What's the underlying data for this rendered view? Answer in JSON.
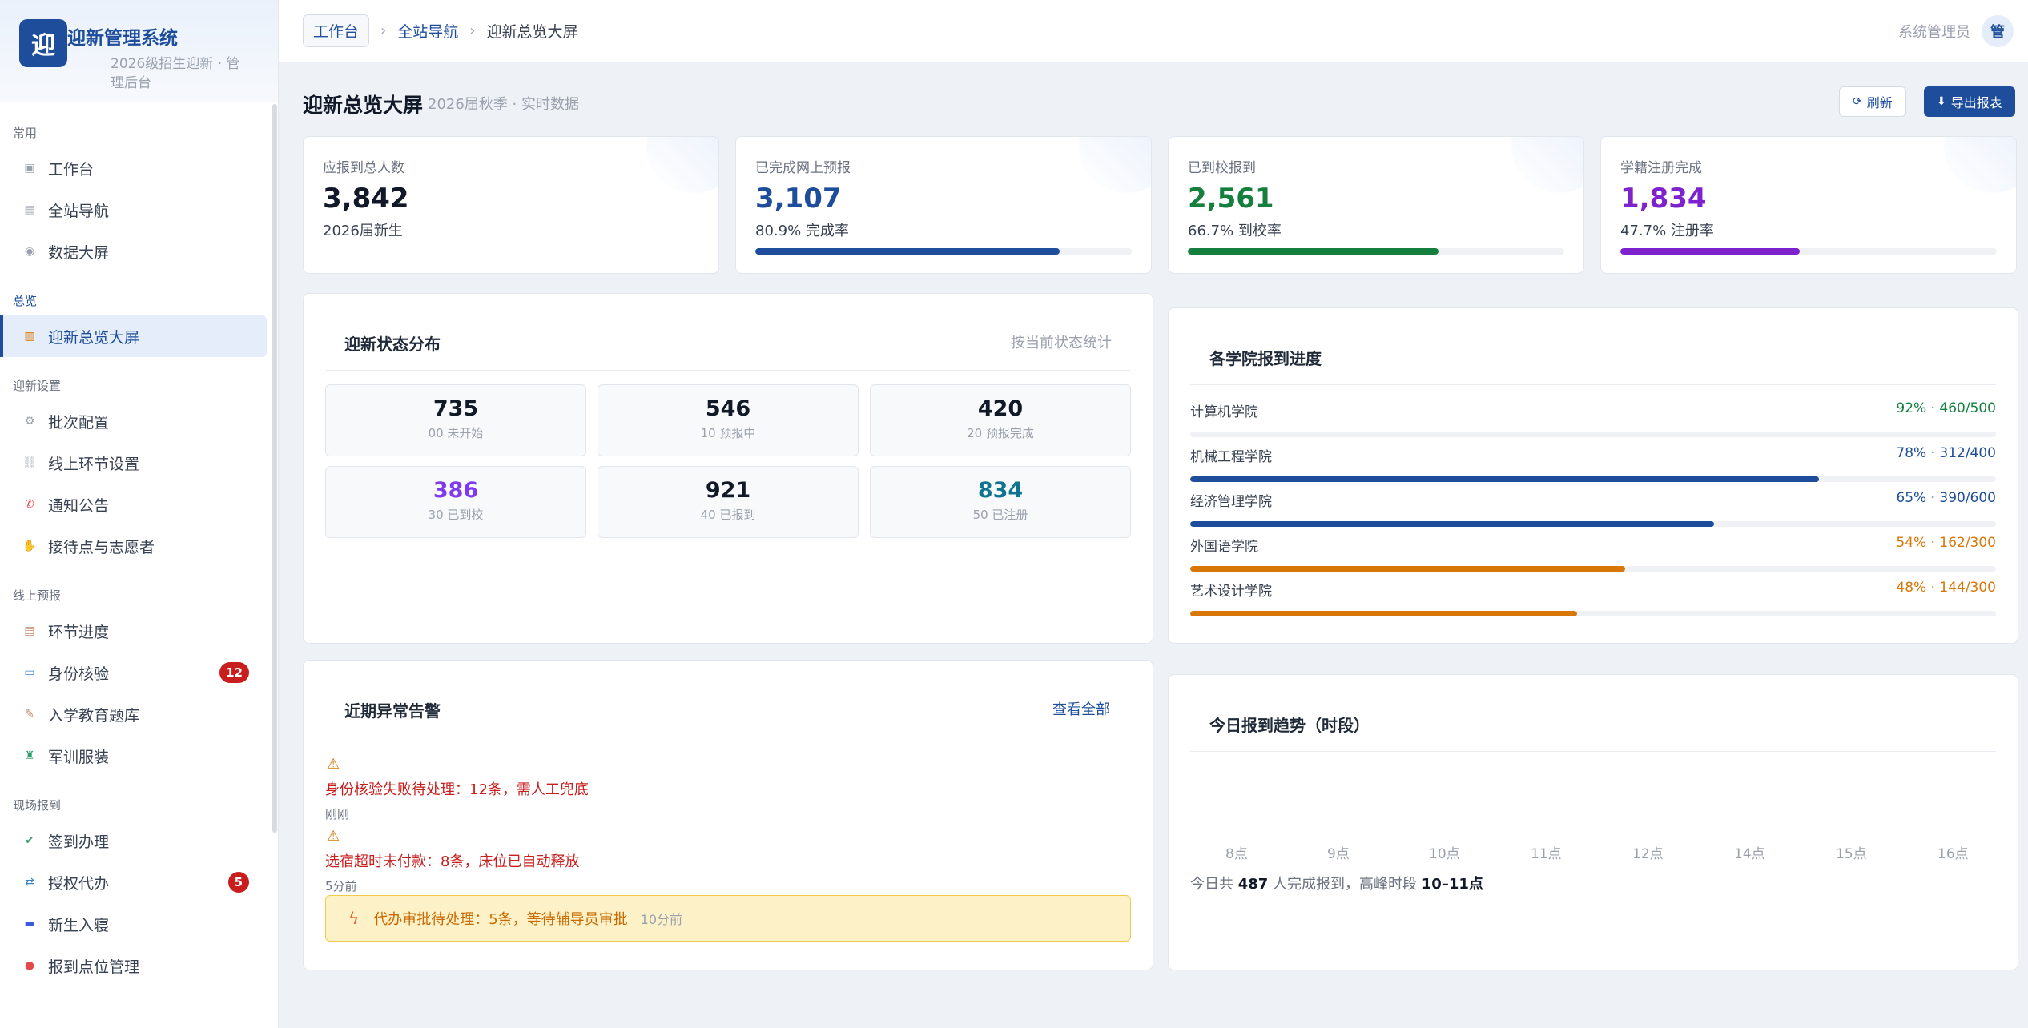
{
  "brand": {
    "logo_char": "迎",
    "title": "迎新管理系统",
    "subtitle": "2026级招生迎新 · 管理后台"
  },
  "sidebar": {
    "groups": [
      {
        "title": "常用",
        "items": [
          {
            "label": "工作台",
            "icon": "workbench-icon"
          },
          {
            "label": "全站导航",
            "icon": "grid-icon"
          },
          {
            "label": "数据大屏",
            "icon": "screen-icon"
          }
        ]
      },
      {
        "title": "总览",
        "items": [
          {
            "label": "迎新总览大屏",
            "icon": "chart-icon"
          }
        ]
      },
      {
        "title": "迎新设置",
        "items": [
          {
            "label": "批次配置",
            "icon": "gear-icon"
          },
          {
            "label": "线上环节设置",
            "icon": "link-icon"
          },
          {
            "label": "通知公告",
            "icon": "megaphone-icon"
          },
          {
            "label": "接待点与志愿者",
            "icon": "volunteer-icon"
          }
        ]
      },
      {
        "title": "线上预报",
        "items": [
          {
            "label": "环节进度",
            "icon": "clipboard-icon"
          },
          {
            "label": "身份核验",
            "icon": "id-card-icon",
            "badge": "12"
          },
          {
            "label": "入学教育题库",
            "icon": "memo-icon"
          },
          {
            "label": "军训服装",
            "icon": "shirt-icon"
          }
        ]
      },
      {
        "title": "现场报到",
        "items": [
          {
            "label": "签到办理",
            "icon": "check-icon"
          },
          {
            "label": "授权代办",
            "icon": "swap-icon",
            "badge": "5"
          },
          {
            "label": "新生入寝",
            "icon": "bed-icon"
          },
          {
            "label": "报到点位管理",
            "icon": "pin-icon"
          }
        ]
      }
    ]
  },
  "topbar": {
    "crumb_home": "工作台",
    "crumb_nav": "全站导航",
    "crumb_current": "迎新总览大屏",
    "admin_name": "系统管理员",
    "admin_avatar": "管"
  },
  "page": {
    "title": "迎新总览大屏",
    "subtitle": "2026届秋季 · 实时数据",
    "refresh_label": "刷新",
    "export_label": "导出报表"
  },
  "stats": [
    {
      "label": "应报到总人数",
      "value": "3,842",
      "desc": "2026届新生",
      "color": "#111827"
    },
    {
      "label": "已完成网上预报",
      "value": "3,107",
      "desc": "80.9% 完成率",
      "color": "#1e4e9b",
      "progress": 0.809
    },
    {
      "label": "已到校报到",
      "value": "2,561",
      "desc": "66.7% 到校率",
      "color": "#15803d",
      "progress": 0.667
    },
    {
      "label": "学籍注册完成",
      "value": "1,834",
      "desc": "47.7% 注册率",
      "color": "#7e22ce",
      "progress": 0.477
    }
  ],
  "status_panel": {
    "title": "迎新状态分布",
    "hint": "按当前状态统计",
    "cells": [
      {
        "value": "735",
        "label": "00 未开始",
        "color": "#111827"
      },
      {
        "value": "546",
        "label": "10 预报中",
        "color": "#111827"
      },
      {
        "value": "420",
        "label": "20 预报完成",
        "color": "#111827"
      },
      {
        "value": "386",
        "label": "30 已到校",
        "color": "#7e3af2"
      },
      {
        "value": "921",
        "label": "40 已报到",
        "color": "#111827"
      },
      {
        "value": "834",
        "label": "50 已注册",
        "color": "#0e7490"
      }
    ]
  },
  "college_panel": {
    "title": "各学院报到进度",
    "rows": [
      {
        "name": "计算机学院",
        "value": "92% · 460/500",
        "progress": 0.0,
        "color": "#15803d",
        "bar": "#1e4e9b"
      },
      {
        "name": "机械工程学院",
        "value": "78% · 312/400",
        "progress": 0.78,
        "color": "#1e4e9b",
        "bar": "#1e4e9b"
      },
      {
        "name": "经济管理学院",
        "value": "65% · 390/600",
        "progress": 0.65,
        "color": "#1e4e9b",
        "bar": "#1e4e9b"
      },
      {
        "name": "外国语学院",
        "value": "54% · 162/300",
        "progress": 0.54,
        "color": "#d97706",
        "bar": "#d97706"
      },
      {
        "name": "艺术设计学院",
        "value": "48% · 144/300",
        "progress": 0.48,
        "color": "#d97706",
        "bar": "#d97706"
      }
    ]
  },
  "alerts_panel": {
    "title": "近期异常告警",
    "link": "查看全部",
    "alerts": [
      {
        "text": "身份核验失败待处理：12条，需人工兜底",
        "time": "刚刚"
      },
      {
        "text": "选宿超时未付款：8条，床位已自动释放",
        "time": "5分前"
      }
    ],
    "highlight": {
      "text": "代办审批待处理：5条，等待辅导员审批",
      "time": "10分前"
    }
  },
  "trend_panel": {
    "title": "今日报到趋势（时段）",
    "x_labels": [
      "8点",
      "9点",
      "10点",
      "11点",
      "12点",
      "14点",
      "15点",
      "16点"
    ],
    "summary_prefix": "今日共",
    "summary_total": "487",
    "summary_mid": "人完成报到，高峰时段",
    "summary_peak": "10–11点"
  }
}
